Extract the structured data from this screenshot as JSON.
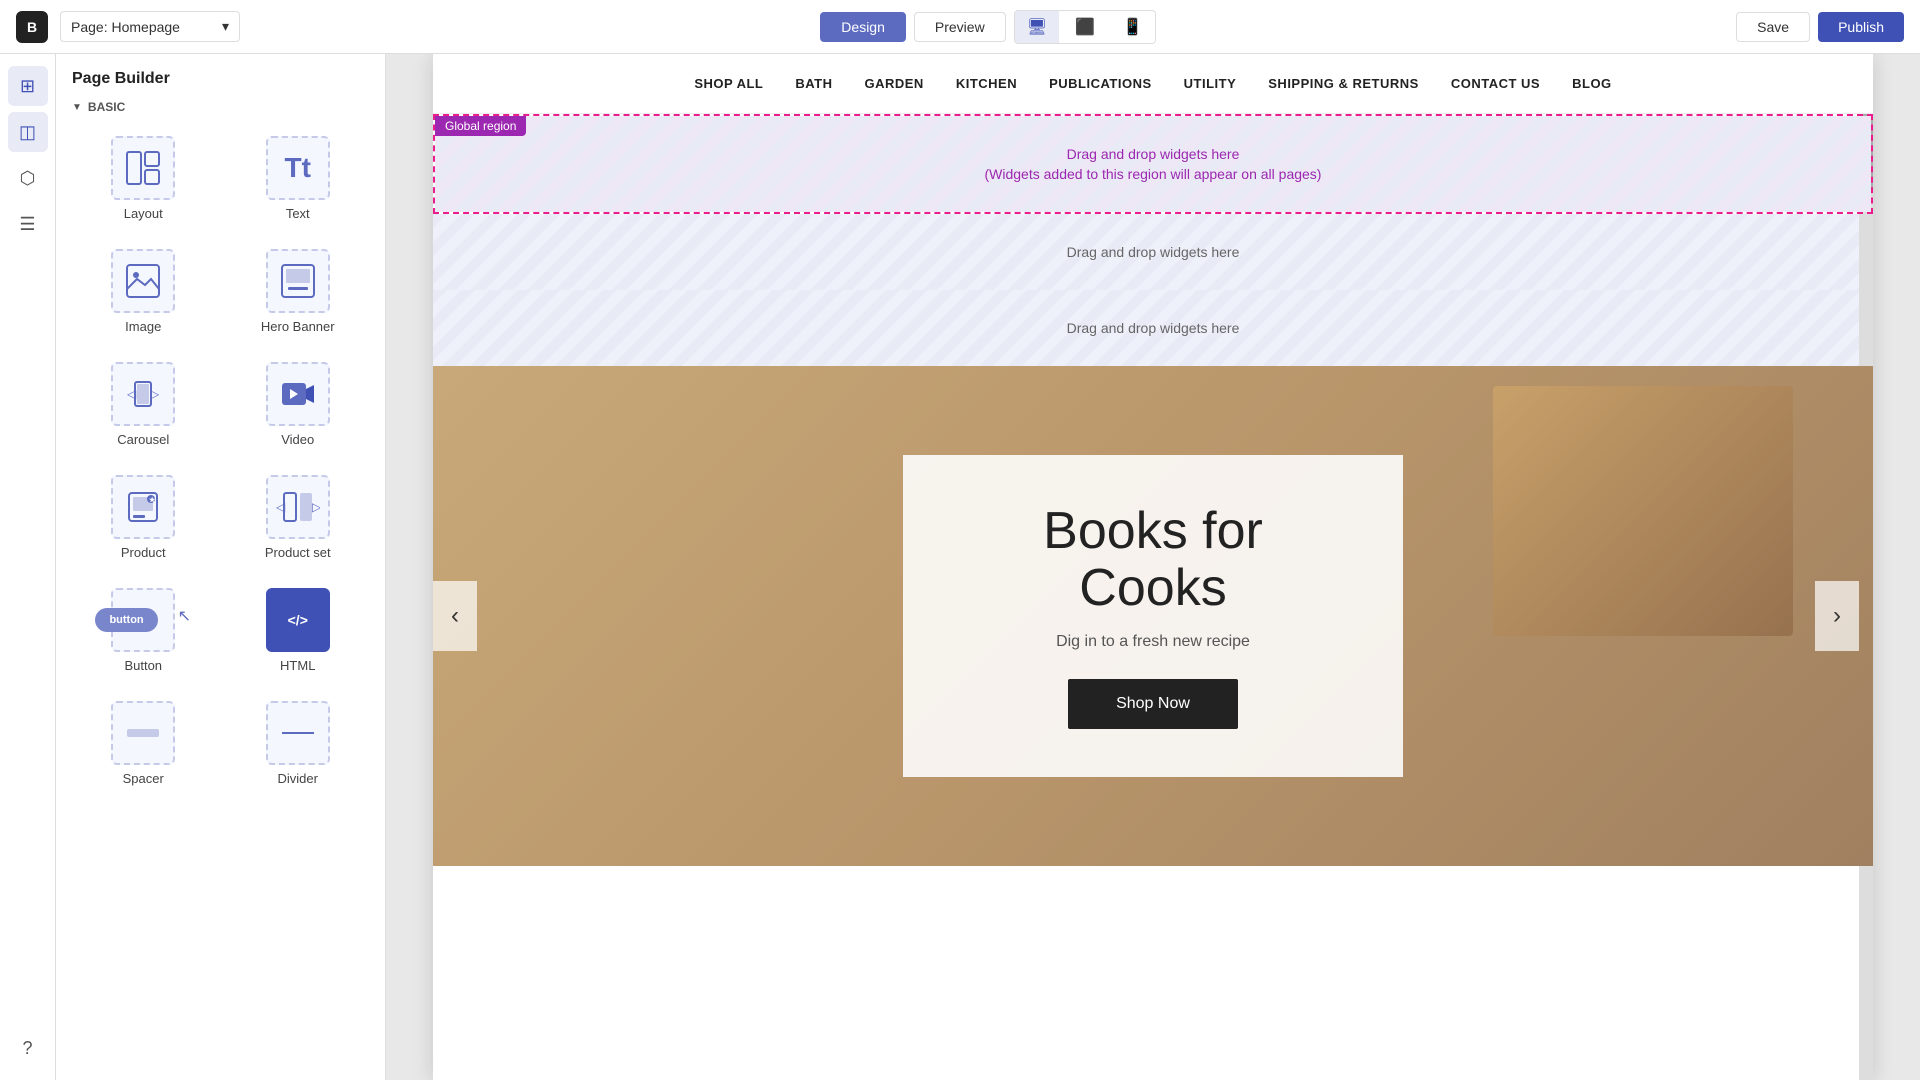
{
  "topbar": {
    "logo": "B",
    "page_selector": "Page: Homepage",
    "tabs": [
      {
        "label": "Design",
        "active": true
      },
      {
        "label": "Preview",
        "active": false
      }
    ],
    "devices": [
      {
        "icon": "🖥",
        "active": true
      },
      {
        "icon": "⬜",
        "active": false
      },
      {
        "icon": "📱",
        "active": false
      }
    ],
    "save_label": "Save",
    "publish_label": "Publish"
  },
  "icon_sidebar": {
    "items": [
      {
        "icon": "⊞",
        "name": "pages-icon"
      },
      {
        "icon": "◫",
        "name": "widgets-icon",
        "active": true
      },
      {
        "icon": "⬡",
        "name": "apps-icon"
      },
      {
        "icon": "☰",
        "name": "menu-icon"
      },
      {
        "icon": "?",
        "name": "help-icon"
      }
    ]
  },
  "widget_panel": {
    "title": "Page Builder",
    "section": "BASIC",
    "widgets": [
      {
        "label": "Layout",
        "icon": "▦",
        "name": "layout-widget"
      },
      {
        "label": "Text",
        "icon": "Tt",
        "name": "text-widget"
      },
      {
        "label": "Image",
        "icon": "🖼",
        "name": "image-widget"
      },
      {
        "label": "Hero Banner",
        "icon": "⊡",
        "name": "hero-banner-widget"
      },
      {
        "label": "Carousel",
        "icon": "◁▷",
        "name": "carousel-widget"
      },
      {
        "label": "Video",
        "icon": "▶",
        "name": "video-widget"
      },
      {
        "label": "Product",
        "icon": "📦",
        "name": "product-widget"
      },
      {
        "label": "Product set",
        "icon": "◁◻▷",
        "name": "product-set-widget"
      },
      {
        "label": "Button",
        "icon": "btn",
        "name": "button-widget"
      },
      {
        "label": "HTML",
        "icon": "</>",
        "name": "html-widget"
      },
      {
        "label": "Spacer",
        "icon": "▭",
        "name": "spacer-widget"
      },
      {
        "label": "Divider",
        "icon": "—",
        "name": "divider-widget"
      }
    ]
  },
  "canvas": {
    "nav_items": [
      {
        "label": "SHOP ALL"
      },
      {
        "label": "BATH"
      },
      {
        "label": "GARDEN"
      },
      {
        "label": "KITCHEN"
      },
      {
        "label": "PUBLICATIONS"
      },
      {
        "label": "UTILITY"
      },
      {
        "label": "SHIPPING & RETURNS"
      },
      {
        "label": "CONTACT US"
      },
      {
        "label": "BLOG"
      }
    ],
    "global_region_label": "Global region",
    "global_drop_text_1": "Drag and drop widgets here",
    "global_drop_text_2": "(Widgets added to this region will appear on all pages)",
    "drop_zone_text": "Drag and drop widgets here",
    "hero": {
      "title": "Books for Cooks",
      "subtitle": "Dig in to a fresh new recipe",
      "cta_label": "Shop Now",
      "prev_label": "‹",
      "next_label": "›"
    }
  }
}
